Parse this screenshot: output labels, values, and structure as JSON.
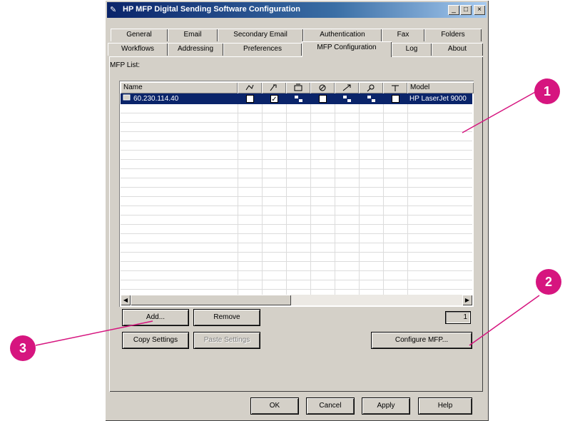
{
  "window": {
    "title": "HP MFP Digital Sending Software Configuration",
    "minimize": "_",
    "maximize": "□",
    "close": "×"
  },
  "tabs_row1": [
    "General",
    "Email",
    "Secondary Email",
    "Authentication",
    "Fax",
    "Folders"
  ],
  "tabs_row2": [
    "Workflows",
    "Addressing",
    "Preferences",
    "MFP Configuration",
    "Log",
    "About"
  ],
  "active_tab": "MFP Configuration",
  "group_label": "MFP List:",
  "list": {
    "columns": [
      "Name",
      "",
      "",
      "",
      "",
      "",
      "",
      "",
      "Model"
    ],
    "rows": [
      {
        "name": "60.230.114.40",
        "col1": false,
        "col2": true,
        "col4": false,
        "col7": false,
        "model": "HP LaserJet 9000"
      }
    ]
  },
  "buttons": {
    "add": "Add...",
    "remove": "Remove",
    "copy": "Copy Settings",
    "paste": "Paste Settings",
    "configure": "Configure MFP...",
    "ok": "OK",
    "cancel": "Cancel",
    "apply": "Apply",
    "help": "Help"
  },
  "count": "1",
  "callouts": [
    "1",
    "2",
    "3"
  ],
  "colors": {
    "callout": "#d6157f",
    "selection": "#0a246a",
    "face": "#d4d0c8"
  }
}
